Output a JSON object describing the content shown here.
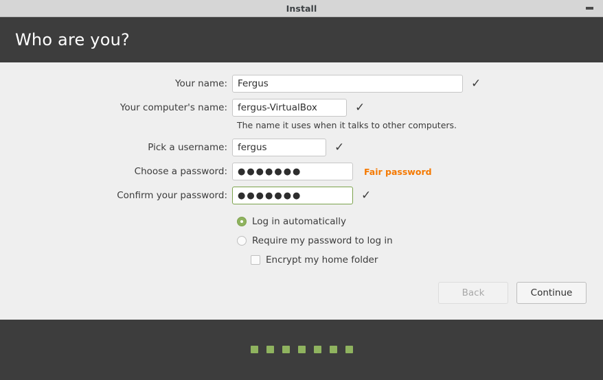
{
  "window": {
    "title": "Install",
    "minimize_label": "minimize"
  },
  "header": {
    "title": "Who are you?"
  },
  "colors": {
    "header_bg": "#3d3d3d",
    "content_bg": "#efefef",
    "titlebar_bg": "#d6d6d6",
    "accent_green": "#8fb35f",
    "warning_orange": "#f57900"
  },
  "form": {
    "fields": [
      {
        "label": "Your name:",
        "value": "Fergus",
        "placeholder": "",
        "valid_mark": "✓"
      },
      {
        "label": "Your computer's name:",
        "value": "fergus-VirtualBox",
        "placeholder": "",
        "valid_mark": "✓",
        "hint": "The name it uses when it talks to other computers."
      },
      {
        "label": "Pick a username:",
        "value": "fergus",
        "placeholder": "",
        "valid_mark": "✓"
      },
      {
        "label": "Choose a password:",
        "value": "●●●●●●●",
        "placeholder": "",
        "strength": "Fair password"
      },
      {
        "label": "Confirm your password:",
        "value": "●●●●●●●",
        "placeholder": "",
        "valid_mark": "✓"
      }
    ]
  },
  "options": {
    "login_auto": "Log in automatically",
    "login_password": "Require my password to log in",
    "encrypt_home": "Encrypt my home folder"
  },
  "actions": {
    "back": "Back",
    "continue": "Continue"
  },
  "progress": {
    "steps": 7
  }
}
